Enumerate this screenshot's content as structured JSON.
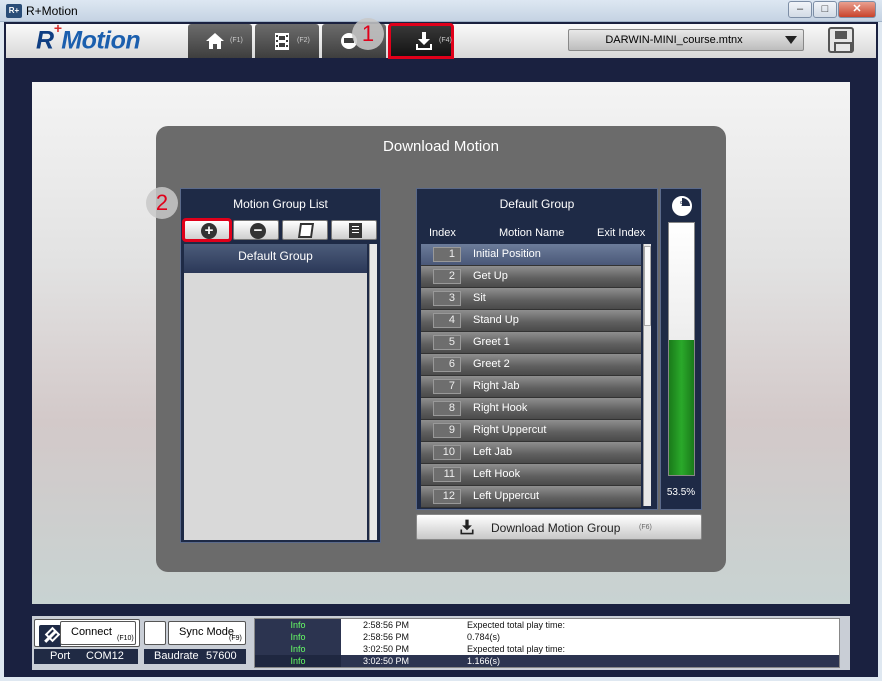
{
  "window": {
    "icon_text": "R+",
    "title": "R+Motion",
    "minimize": "‒",
    "maximize": "□",
    "close": "✕"
  },
  "header": {
    "logo_r": "R",
    "logo_plus": "+",
    "logo_rest": "Motion",
    "tabs": [
      {
        "name": "home",
        "key": "(F1)",
        "icon": "home-icon"
      },
      {
        "name": "motion-edit",
        "key": "(F2)",
        "icon": "film-icon"
      },
      {
        "name": "simulation",
        "key": "",
        "icon": "robot-icon"
      },
      {
        "name": "download",
        "key": "(F4)",
        "icon": "download-icon"
      }
    ],
    "file_selected": "DARWIN-MINI_course.mtnx",
    "badge1": "1"
  },
  "panel": {
    "title": "Download Motion",
    "group_list": {
      "title": "Motion Group List",
      "items": [
        "Default Group"
      ],
      "badge2": "2",
      "add": "+",
      "remove": "−"
    },
    "motion_table": {
      "title": "Default Group",
      "headers": {
        "index": "Index",
        "name": "Motion Name",
        "exit": "Exit Index"
      },
      "rows": [
        {
          "index": "1",
          "name": "Initial Position"
        },
        {
          "index": "2",
          "name": "Get Up"
        },
        {
          "index": "3",
          "name": "Sit"
        },
        {
          "index": "4",
          "name": "Stand Up"
        },
        {
          "index": "5",
          "name": "Greet 1"
        },
        {
          "index": "6",
          "name": "Greet 2"
        },
        {
          "index": "7",
          "name": "Right Jab"
        },
        {
          "index": "8",
          "name": "Right Hook"
        },
        {
          "index": "9",
          "name": "Right Uppercut"
        },
        {
          "index": "10",
          "name": "Left Jab"
        },
        {
          "index": "11",
          "name": "Left Hook"
        },
        {
          "index": "12",
          "name": "Left Uppercut"
        }
      ]
    },
    "usage": {
      "pie_label": "%",
      "percent": "53.5%",
      "fill": 0.535
    },
    "download_button": {
      "label": "Download Motion Group",
      "key": "(F6)"
    }
  },
  "status": {
    "connect": "Connect",
    "connect_key": "(F10)",
    "sync_mode": "Sync Mode",
    "sync_key": "(F9)",
    "port_label": "Port",
    "port_value": "COM12",
    "baud_label": "Baudrate",
    "baud_value": "57600",
    "log": [
      {
        "level": "Info",
        "time": "2:58:56 PM",
        "msg": "Expected total play time:"
      },
      {
        "level": "Info",
        "time": "2:58:56 PM",
        "msg": "0.784(s)"
      },
      {
        "level": "Info",
        "time": "3:02:50 PM",
        "msg": "Expected total play time:"
      },
      {
        "level": "Info",
        "time": "3:02:50 PM",
        "msg": "1.166(s)"
      }
    ]
  },
  "colors": {
    "highlight": "#e0001a",
    "progress": "#2aa92a",
    "panel": "#6b6b6b",
    "navy": "#1e2a46"
  }
}
